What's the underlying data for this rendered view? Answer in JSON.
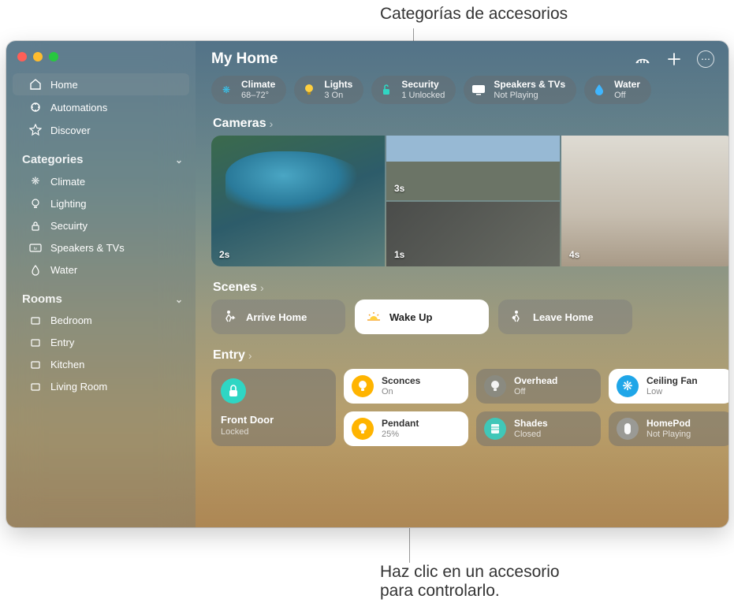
{
  "callouts": {
    "top": "Categorías de accesorios",
    "bottom_line1": "Haz clic en un accesorio",
    "bottom_line2": "para controlarlo."
  },
  "window": {
    "title": "My Home"
  },
  "sidebar": {
    "nav": [
      {
        "label": "Home",
        "icon": "home"
      },
      {
        "label": "Automations",
        "icon": "automations"
      },
      {
        "label": "Discover",
        "icon": "star"
      }
    ],
    "sections": [
      {
        "title": "Categories",
        "items": [
          {
            "label": "Climate",
            "icon": "fan"
          },
          {
            "label": "Lighting",
            "icon": "bulb"
          },
          {
            "label": "Secuirty",
            "icon": "lock"
          },
          {
            "label": "Speakers & TVs",
            "icon": "tv"
          },
          {
            "label": "Water",
            "icon": "drop"
          }
        ]
      },
      {
        "title": "Rooms",
        "items": [
          {
            "label": "Bedroom",
            "icon": "room"
          },
          {
            "label": "Entry",
            "icon": "room"
          },
          {
            "label": "Kitchen",
            "icon": "room"
          },
          {
            "label": "Living Room",
            "icon": "room"
          }
        ]
      }
    ]
  },
  "pills": [
    {
      "label": "Climate",
      "status": "68–72°",
      "color": "#36c6f0",
      "icon": "fan"
    },
    {
      "label": "Lights",
      "status": "3 On",
      "color": "#ffcf3f",
      "icon": "bulb"
    },
    {
      "label": "Security",
      "status": "1 Unlocked",
      "color": "#30d6c3",
      "icon": "lock"
    },
    {
      "label": "Speakers & TVs",
      "status": "Not Playing",
      "color": "#ffffff",
      "icon": "tv"
    },
    {
      "label": "Water",
      "status": "Off",
      "color": "#3fb6ff",
      "icon": "drop"
    }
  ],
  "sections": {
    "cameras": {
      "title": "Cameras",
      "feeds": [
        {
          "ts": "2s"
        },
        {
          "ts": "3s"
        },
        {
          "ts": "4s"
        },
        {
          "ts": "1s"
        }
      ]
    },
    "scenes": {
      "title": "Scenes",
      "items": [
        {
          "label": "Arrive Home",
          "active": false
        },
        {
          "label": "Wake Up",
          "active": true
        },
        {
          "label": "Leave Home",
          "active": false
        }
      ]
    },
    "entry": {
      "title": "Entry",
      "tiles": [
        {
          "name": "Front Door",
          "status": "Locked",
          "style": "tall-dark",
          "icon": "lock",
          "iconBg": "#2fd6c4"
        },
        {
          "name": "Sconces",
          "status": "On",
          "style": "on",
          "icon": "bulb",
          "iconBg": "#ffb400"
        },
        {
          "name": "Overhead",
          "status": "Off",
          "style": "dark",
          "icon": "bulb",
          "iconBg": "#8a8a80"
        },
        {
          "name": "Ceiling Fan",
          "status": "Low",
          "style": "on",
          "icon": "fan",
          "iconBg": "#1fa6e8"
        },
        {
          "name": "Pendant",
          "status": "25%",
          "style": "on",
          "icon": "bulb",
          "iconBg": "#ffb400"
        },
        {
          "name": "Shades",
          "status": "Closed",
          "style": "dark",
          "icon": "shades",
          "iconBg": "#40c7b8"
        },
        {
          "name": "HomePod",
          "status": "Not Playing",
          "style": "dark",
          "icon": "speaker",
          "iconBg": "#9a9a95"
        }
      ]
    }
  }
}
